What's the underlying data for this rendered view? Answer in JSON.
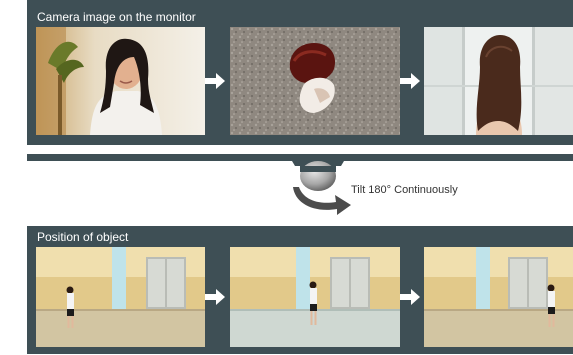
{
  "top_panel": {
    "title": "Camera image on the monitor"
  },
  "bottom_panel": {
    "title": "Position of object"
  },
  "camera": {
    "tilt_label": "Tilt 180° Continuously"
  },
  "colors": {
    "panel": "#3e4f55",
    "arrow": "#ffffff",
    "camera_dome": "#a7a7a7",
    "tilt_arrow": "#4c4c4c"
  },
  "icons": {
    "step_arrow": "arrow-right-icon",
    "camera": "dome-camera-icon",
    "tilt": "curved-arrow-icon"
  }
}
